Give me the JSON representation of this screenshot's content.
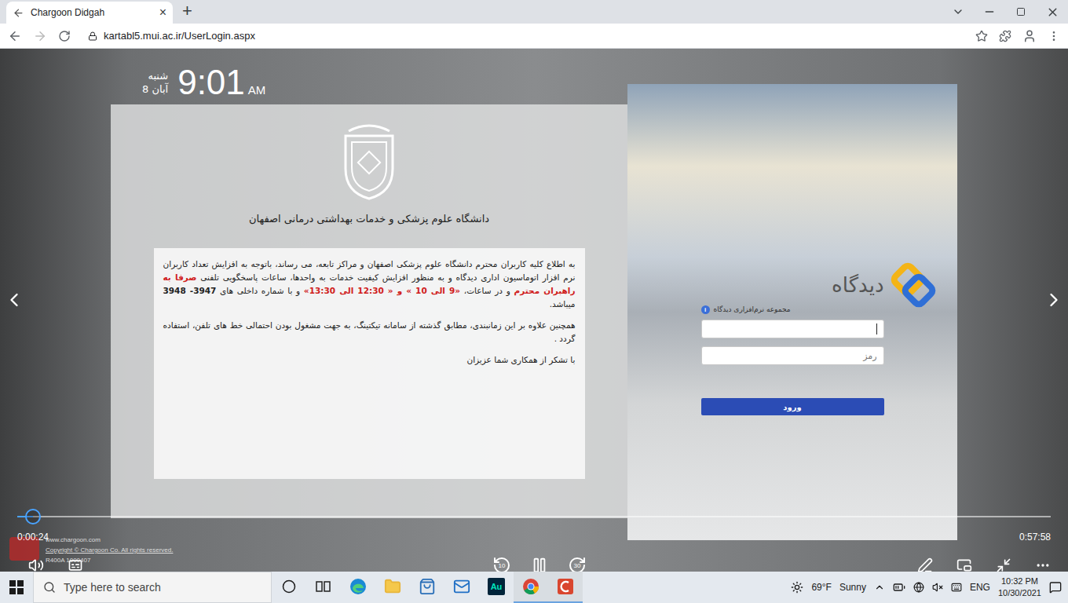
{
  "browser": {
    "tab": {
      "title": "Chargoon Didgah",
      "close": "×",
      "selected": true
    },
    "new_tab": "+",
    "url": "kartabl5.mui.ac.ir/UserLogin.aspx"
  },
  "page": {
    "clock": {
      "day": "شنبه",
      "date": "8 آبان",
      "time": "9:01",
      "meridiem": "AM"
    },
    "university": "دانشگاه علوم پزشکی و خدمات بهداشتی درمانی اصفهان",
    "notice": [
      {
        "segments": [
          {
            "text": "به اطلاع کلیه کاربران محترم دانشگاه علوم پزشکی اصفهان و مراکز تابعه، می رساند، باتوجه به افزایش تعداد کاربران نرم افزار اتوماسیون اداری دیدگاه و به منظور افزایش کیفیت خدمات به واحدها، ساعات پاسخگویی تلفنی ",
            "tone": "plain"
          },
          {
            "text": "صرفا به راهبران محترم",
            "tone": "red"
          },
          {
            "text": " و در ساعات، ",
            "tone": "plain"
          },
          {
            "text": "«9 الی 10 » و « 12:30 الی 13:30»",
            "tone": "red"
          },
          {
            "text": " و با شماره داخلی های ",
            "tone": "plain"
          },
          {
            "text": "3947- 3948",
            "tone": "bold"
          },
          {
            "text": " میباشد.",
            "tone": "plain"
          }
        ]
      },
      {
        "segments": [
          {
            "text": "همچنین علاوه بر این زمانبندی، مطابق گذشته از سامانه تیکتینگ، به جهت مشغول بودن احتمالی خط های تلفن، استفاده گردد .",
            "tone": "plain"
          }
        ]
      },
      {
        "segments": [
          {
            "text": "با تشکر از همکاری شما عزیزان",
            "tone": "plain"
          }
        ]
      }
    ],
    "login": {
      "logo": "دیدگاه",
      "suite_label": "مجموعه نرم‌افزاری دیدگاه",
      "info": "i",
      "username": {
        "value": "",
        "focused": true
      },
      "password": {
        "placeholder": "رمز"
      },
      "submit": "ورود"
    },
    "footer": [
      "www.chargoon.com",
      "Copyright © Chargoon Co. All rights reserved.",
      "R400A 1000407"
    ]
  },
  "player": {
    "elapsed": "0:00:24",
    "remaining": "0:57:58",
    "level": 0.015,
    "playing": true,
    "rewind": "10",
    "forward": "30"
  },
  "taskbar": {
    "search_placeholder": "Type here to search",
    "apps": [
      {
        "kind": "cortana",
        "active": false
      },
      {
        "kind": "taskview",
        "active": false
      },
      {
        "kind": "edge",
        "active": false
      },
      {
        "kind": "explorer",
        "active": false
      },
      {
        "kind": "store",
        "active": false
      },
      {
        "kind": "mail",
        "active": false
      },
      {
        "kind": "audition",
        "label": "Au",
        "active": false
      },
      {
        "kind": "chrome",
        "active": true
      },
      {
        "kind": "camtasia",
        "active": true
      }
    ],
    "weather": {
      "temp": "69°F",
      "condition": "Sunny"
    },
    "language": "ENG",
    "time": "10:32 PM",
    "date": "10/30/2021"
  }
}
